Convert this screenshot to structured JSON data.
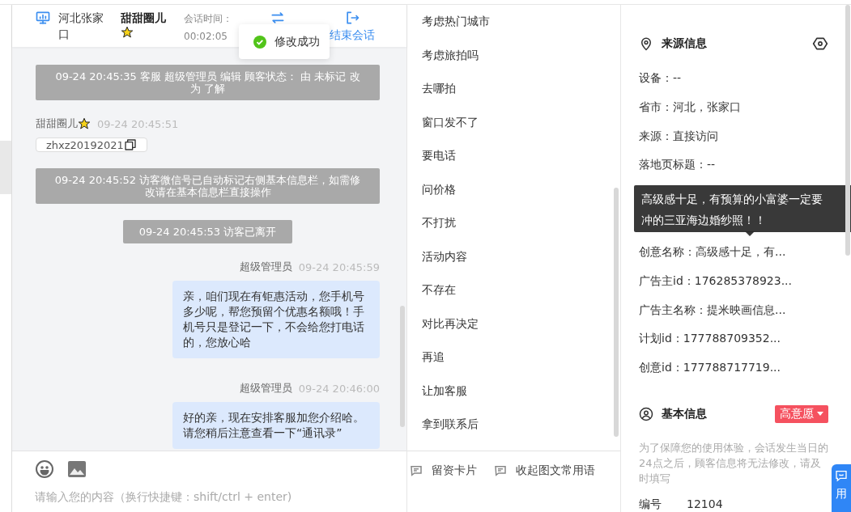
{
  "header": {
    "location": "河北张家口",
    "visitor": "甜甜圈儿",
    "session_label": "会话时间：",
    "session_time": "00:02:05",
    "end_label": "结束会话"
  },
  "toast": {
    "text": "修改成功"
  },
  "messages": [
    {
      "kind": "system",
      "wide": true,
      "text": "09-24 20:45:35 客服 超级管理员 编辑 顾客状态： 由 未标记 改为 了解"
    },
    {
      "kind": "visitor",
      "name": "甜甜圈儿",
      "time": "09-24 20:45:51",
      "card": "zhxz20192021"
    },
    {
      "kind": "system",
      "wide": true,
      "text": "09-24 20:45:52 访客微信号已自动标记右侧基本信息栏，如需修改请在基本信息栏直接操作"
    },
    {
      "kind": "system",
      "wide": false,
      "text": "09-24 20:45:53 访客已离开"
    },
    {
      "kind": "agent",
      "name": "超级管理员",
      "time": "09-24 20:45:59",
      "text": "亲，咱们现在有钜惠活动，您手机号多少呢，帮您预留个优惠名额哦！手机号只是登记一下，不会给您打电话的，您放心哈"
    },
    {
      "kind": "agent",
      "name": "超级管理员",
      "time": "09-24 20:46:00",
      "text": "好的亲，现在安排客服加您介绍哈。请您稍后注意查看一下“通讯录”"
    }
  ],
  "input": {
    "placeholder": "请输入您的内容（换行快捷键：shift/ctrl + enter)"
  },
  "quick_phrases": [
    "考虑热门城市",
    "考虑旅拍吗",
    "去哪拍",
    "窗口发不了",
    "要电话",
    "问价格",
    "不打扰",
    "活动内容",
    "不存在",
    "对比再决定",
    "再追",
    "让加客服",
    "拿到联系后"
  ],
  "quick_buttons": [
    "留资卡片",
    "收起图文常用语"
  ],
  "source_info": {
    "title": "来源信息",
    "rows_before": [
      "设备：--",
      "省市：河北，张家口",
      "来源：直接访问",
      "落地页标题：--"
    ],
    "tooltip": "高级感十足，有预算的小富婆一定要冲的三亚海边婚纱照！！",
    "rows_after": [
      "创意名称：高级感十足，有...",
      "广告主id：176285378923...",
      "广告主名称：提米映画信息...",
      "计划id：177788709352...",
      "创意id：177788717719..."
    ]
  },
  "basic_info": {
    "title": "基本信息",
    "tag": "高意愿",
    "note": "为了保障您的使用体验，会话发生当日的24点之后，顾客信息将无法修改，请及时填写",
    "fields": [
      {
        "label": "编号",
        "value": "12104"
      }
    ]
  },
  "float_button": {
    "label": "用"
  }
}
